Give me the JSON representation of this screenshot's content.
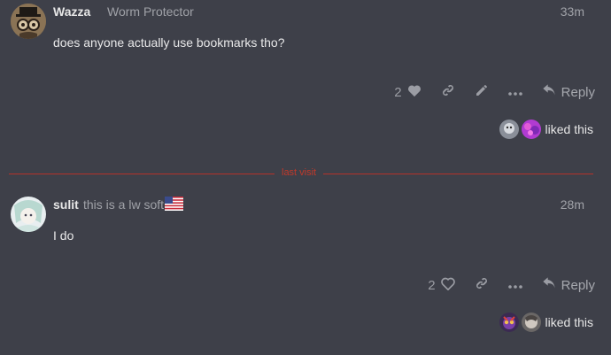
{
  "posts": [
    {
      "author": "Wazza",
      "user_title": "Worm Protector",
      "time": "33m",
      "content": "does anyone actually use bookmarks tho?",
      "like_count": "2",
      "reply_label": "Reply",
      "liked_text": "liked this"
    },
    {
      "author": "sulit",
      "user_title": "this is a lw soft",
      "time": "28m",
      "content": "I do",
      "like_count": "2",
      "reply_label": "Reply",
      "liked_text": "liked this"
    }
  ],
  "divider_label": "last visit",
  "icons": {
    "heart_filled": "heart-icon",
    "heart_outline": "heart-outline-icon",
    "link": "link-icon",
    "pencil": "pencil-icon",
    "more": "more-icon",
    "reply": "reply-icon"
  },
  "colors": {
    "background": "#3e4049",
    "divider": "#b5322a",
    "muted": "#9b9da4"
  }
}
